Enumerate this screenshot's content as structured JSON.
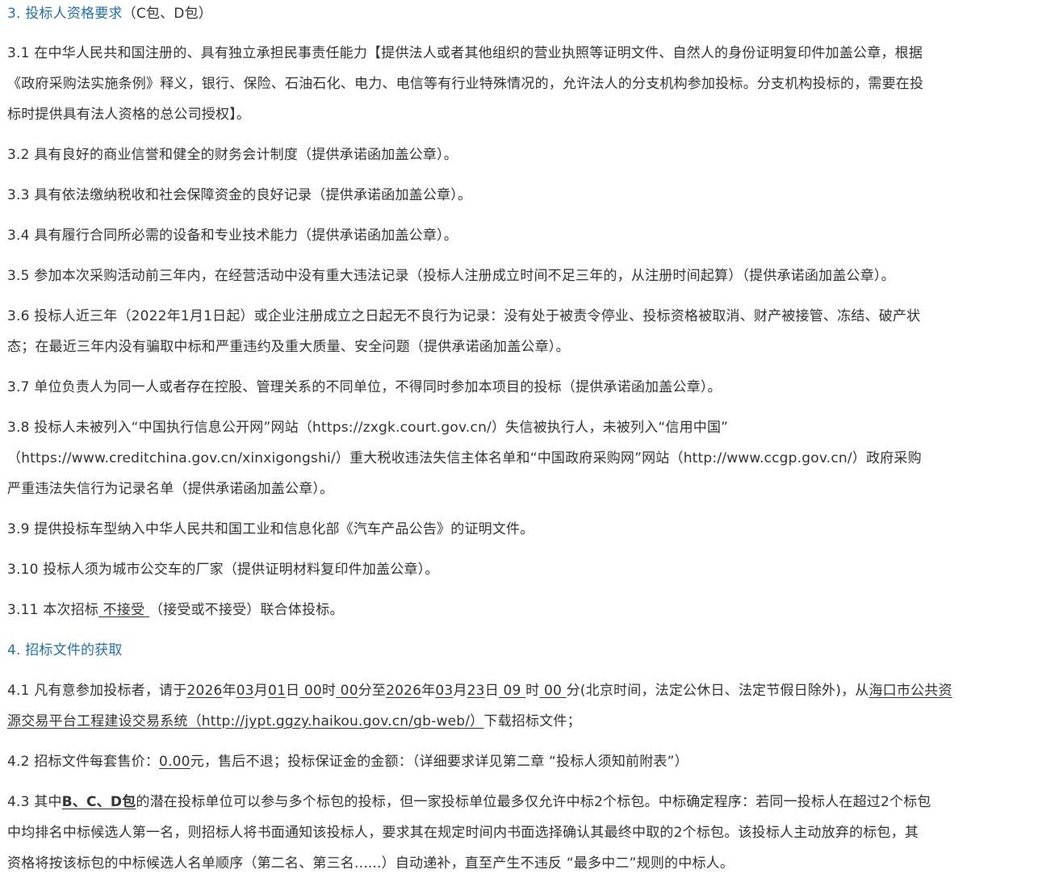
{
  "section3": {
    "heading_num": "3.",
    "heading_title": "投标人资格要求",
    "heading_suffix": "（C包、D包）",
    "items": {
      "r1_l1": "3.1 在中华人民共和国注册的、具有独立承担民事责任能力【提供法人或者其他组织的营业执照等证明文件、自然人的身份证明复印件加盖公章，根据",
      "r1_l2": "《政府采购法实施条例》释义，银行、保险、石油石化、电力、电信等有行业特殊情况的，允许法人的分支机构参加投标。分支机构投标的，需要在投",
      "r1_l3": "标时提供具有法人资格的总公司授权】。",
      "r2": "3.2 具有良好的商业信誉和健全的财务会计制度（提供承诺函加盖公章）。",
      "r3": "3.3 具有依法缴纳税收和社会保障资金的良好记录（提供承诺函加盖公章）。",
      "r4": "3.4 具有履行合同所必需的设备和专业技术能力（提供承诺函加盖公章）。",
      "r5": "3.5 参加本次采购活动前三年内，在经营活动中没有重大违法记录（投标人注册成立时间不足三年的，从注册时间起算）（提供承诺函加盖公章）。",
      "r6_l1": "3.6 投标人近三年（2022年1月1日起）或企业注册成立之日起无不良行为记录：没有处于被责令停业、投标资格被取消、财产被接管、冻结、破产状",
      "r6_l2": "态；在最近三年内没有骗取中标和严重违约及重大质量、安全问题（提供承诺函加盖公章）。",
      "r7": "3.7 单位负责人为同一人或者存在控股、管理关系的不同单位，不得同时参加本项目的投标（提供承诺函加盖公章）。",
      "r8_l1": "3.8 投标人未被列入“中国执行信息公开网”网站（https://zxgk.court.gov.cn/）失信被执行人，未被列入“信用中国”",
      "r8_l2": "（https://www.creditchina.gov.cn/xinxigongshi/）重大税收违法失信主体名单和“中国政府采购网”网站（http://www.ccgp.gov.cn/）政府采购",
      "r8_l3": "严重违法失信行为记录名单（提供承诺函加盖公章）。",
      "r9": "3.9 提供投标车型纳入中华人民共和国工业和信息化部《汽车产品公告》的证明文件。",
      "r10": "3.10 投标人须为城市公交车的厂家（提供证明材料复印件加盖公章）。",
      "r11_pre": "3.11 本次招标",
      "r11_u": " 不接受 ",
      "r11_post": "（接受或不接受）联合体投标。"
    }
  },
  "section4": {
    "heading_num": "4.",
    "heading_title": "招标文件的获取",
    "p1": {
      "t0": "4.1 凡有意参加投标者，请于",
      "d1": "2026",
      "t1": "年",
      "d2": "03",
      "t2": "月",
      "d3": "01",
      "t3": "日",
      "d4": " 00",
      "t4": "时",
      "d5": " 00",
      "t5": "分至",
      "d6": "2026",
      "t6": "年",
      "d7": "03",
      "t7": "月",
      "d8": "23",
      "t8": "日",
      "d9": " 09 ",
      "t9": "时",
      "d10": " 00 ",
      "t10": "分(北京时间，法定公休日、法定节假日除外)，从",
      "u1": "海口市公共资",
      "u2": "源交易平台工程建设交易系统（http://jypt.ggzy.haikou.gov.cn/gb-web/）",
      "t11": "下载招标文件；"
    },
    "p2": {
      "t0": "4.2 招标文件每套售价：",
      "price": "0.00",
      "t1": "元，售后不退；投标保证金的金额：（详细要求详见第二章 “投标人须知前附表”）"
    },
    "p3": {
      "t0": "4.3 其中",
      "bold": "B、C、D包",
      "t1": "的潜在投标单位可以参与多个标包的投标，但一家投标单位最多仅允许中标2个标包。中标确定程序：若同一投标人在超过2个标包",
      "l2": "中均排名中标候选人第一名，则招标人将书面通知该投标人，要求其在规定时间内书面选择确认其最终中取的2个标包。该投标人主动放弃的标包，其",
      "l3": "资格将按该标包的中标候选人名单顺序（第二名、第三名......）自动递补，直至产生不违反 “最多中二”规则的中标人。"
    }
  }
}
